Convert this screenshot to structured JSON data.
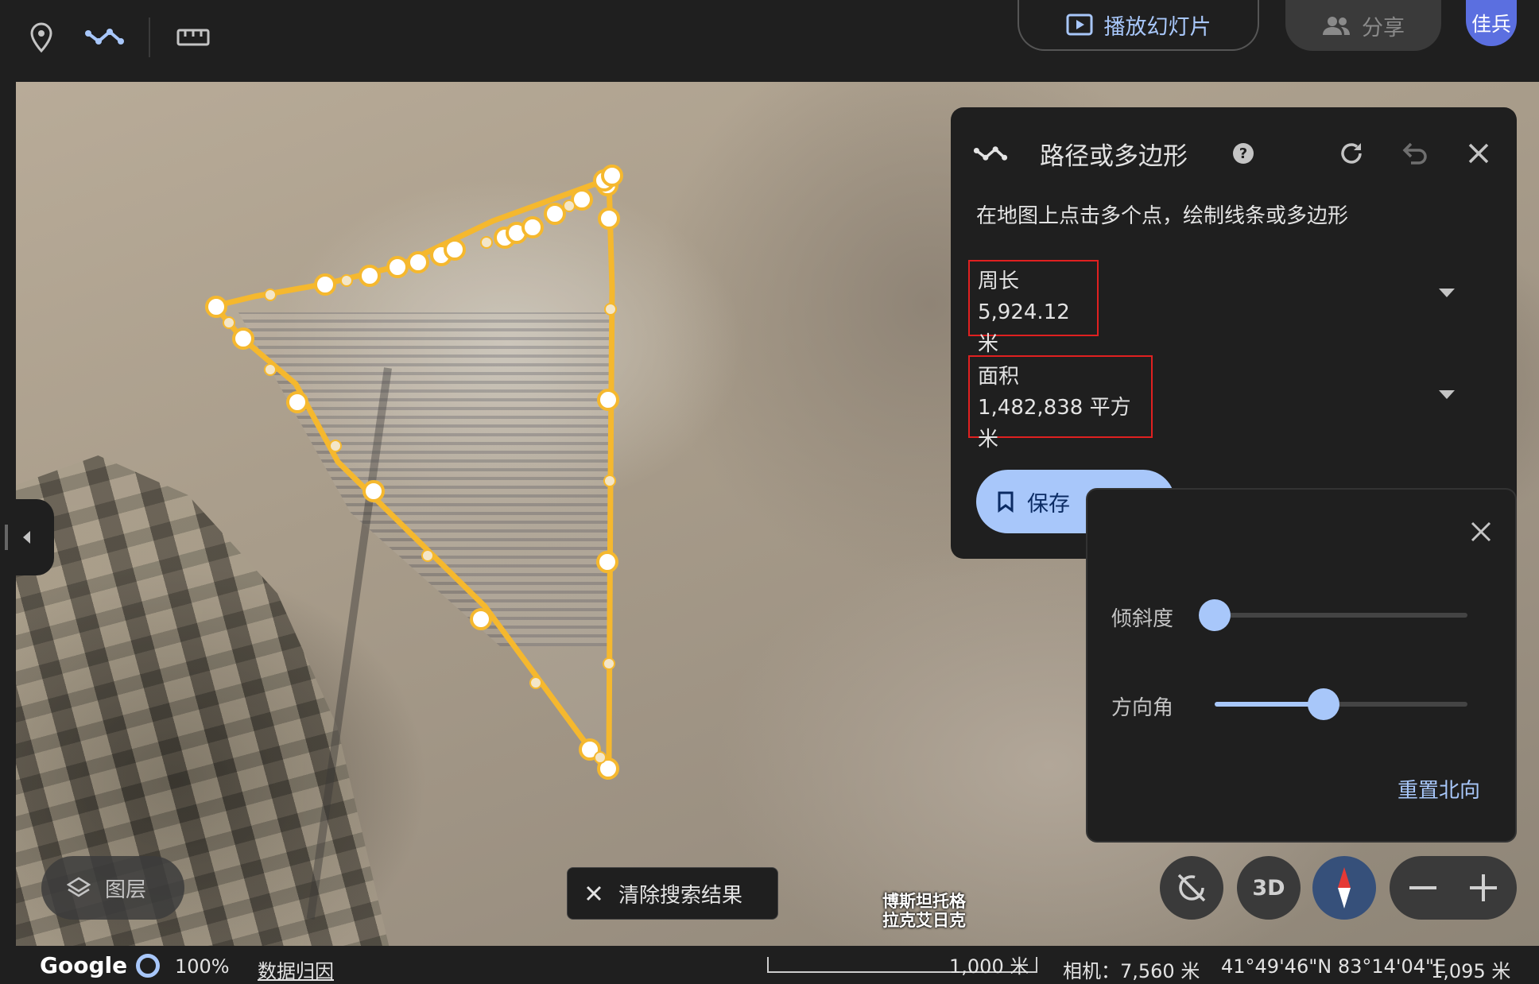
{
  "toolbar": {
    "slideshow_label": "播放幻灯片",
    "share_label": "分享",
    "avatar_text": "佳兵"
  },
  "panel": {
    "title": "路径或多边形",
    "hint": "在地图上点击多个点，绘制线条或多边形",
    "perimeter_label": "周长",
    "perimeter_value": "5,924.12 米",
    "area_label": "面积",
    "area_value": "1,482,838 平方米",
    "save_label": "保存"
  },
  "camera_panel": {
    "tilt_label": "倾斜度",
    "tilt_value": 0,
    "heading_label": "方向角",
    "heading_value": 0.43,
    "reset_label": "重置北向"
  },
  "map": {
    "layers_label": "图层",
    "clear_label": "清除搜索结果",
    "btn_3d": "3D",
    "place_label_line1": "博斯坦托格",
    "place_label_line2": "拉克艾日克",
    "accent_color": "#a8c7fa",
    "path_color": "#f5b82e"
  },
  "status": {
    "brand": "Google",
    "loading": "100%",
    "attribution": "数据归因",
    "scale": "1,000 米",
    "camera": "相机：7,560 米",
    "coords": "41°49'46\"N 83°14'04\"E",
    "elevation": "1,095 米"
  }
}
